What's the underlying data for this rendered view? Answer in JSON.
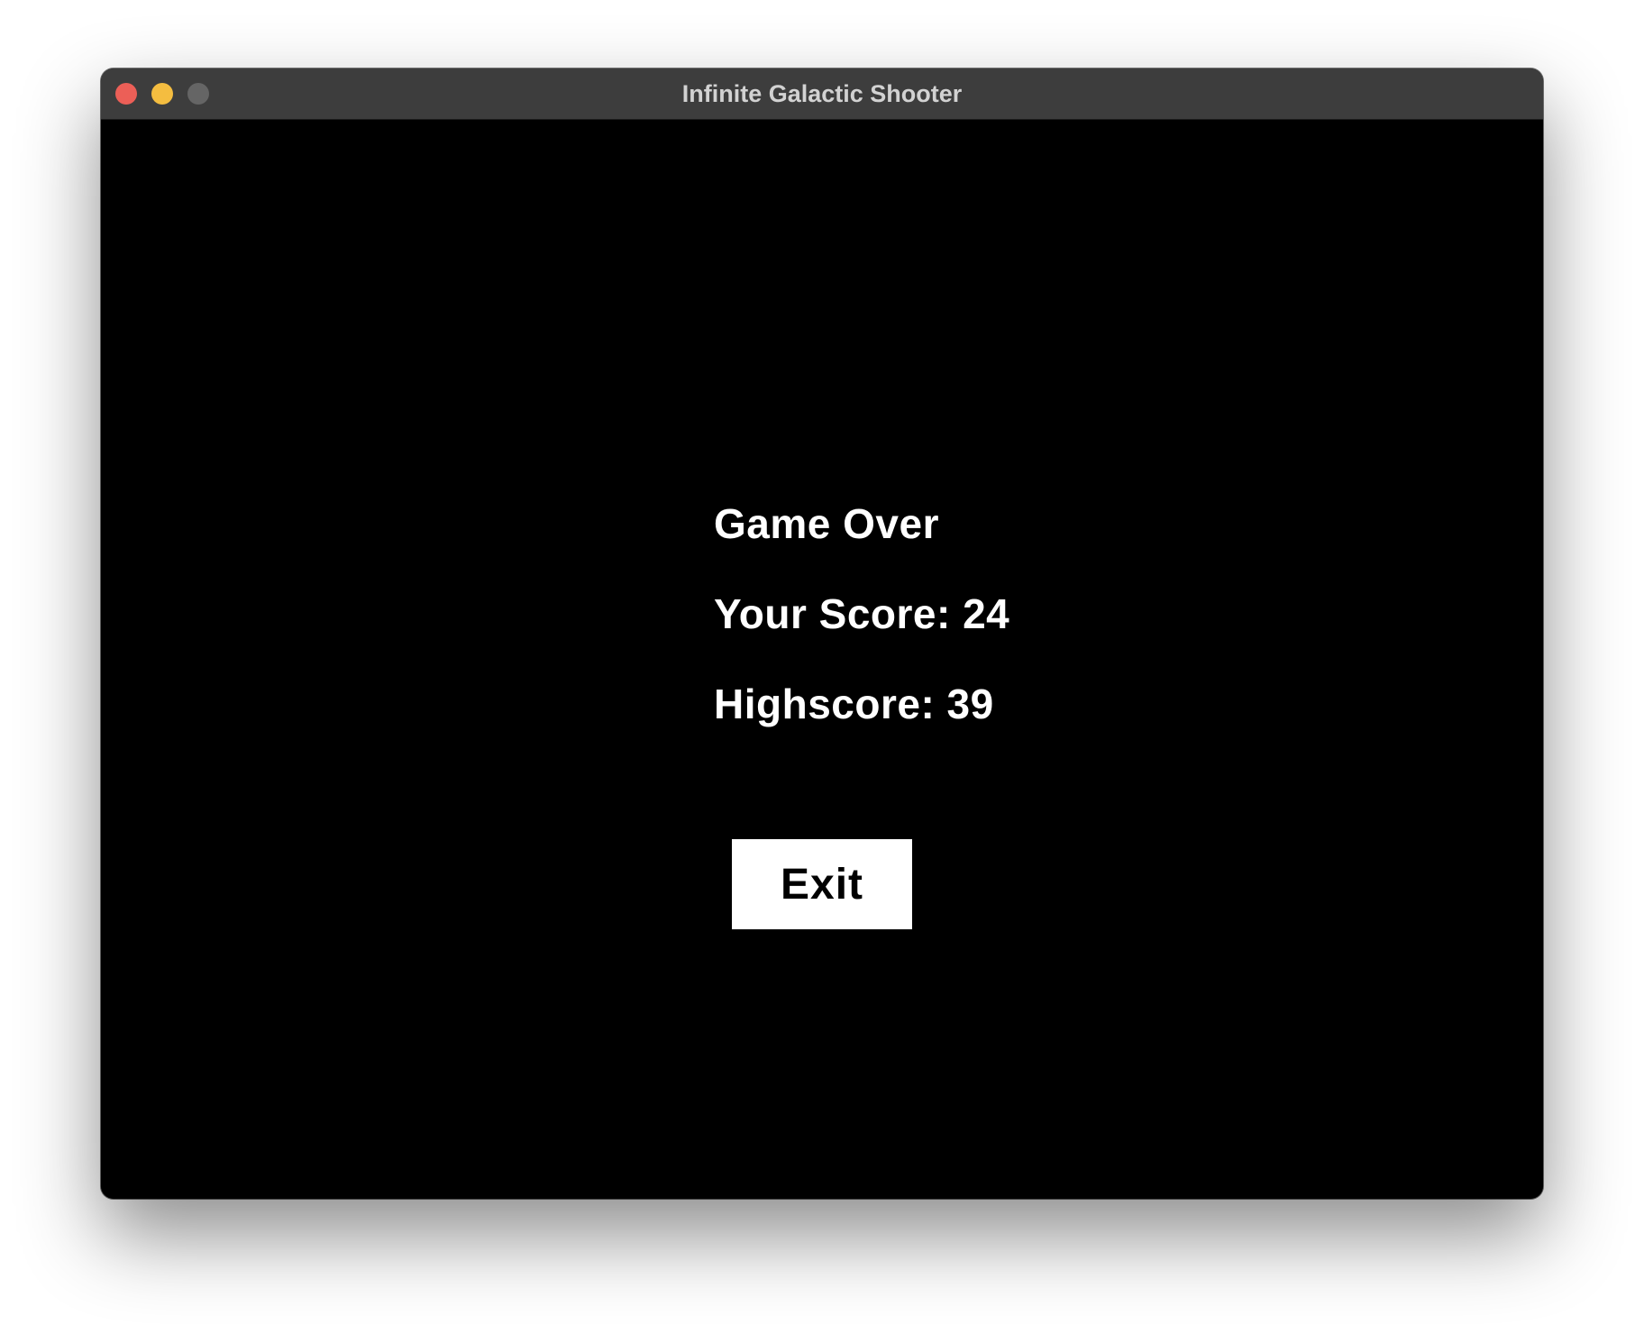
{
  "window": {
    "title": "Infinite Galactic Shooter",
    "controls": {
      "close_color": "#ec5f57",
      "minimize_color": "#f4bd40",
      "zoom_color": "#656565"
    }
  },
  "game_over_screen": {
    "heading": "Game Over",
    "score_text": "Your Score: 24",
    "highscore_text": "Highscore: 39",
    "score": 24,
    "highscore": 39,
    "exit_label": "Exit",
    "background_color": "#000000",
    "text_color": "#ffffff"
  }
}
